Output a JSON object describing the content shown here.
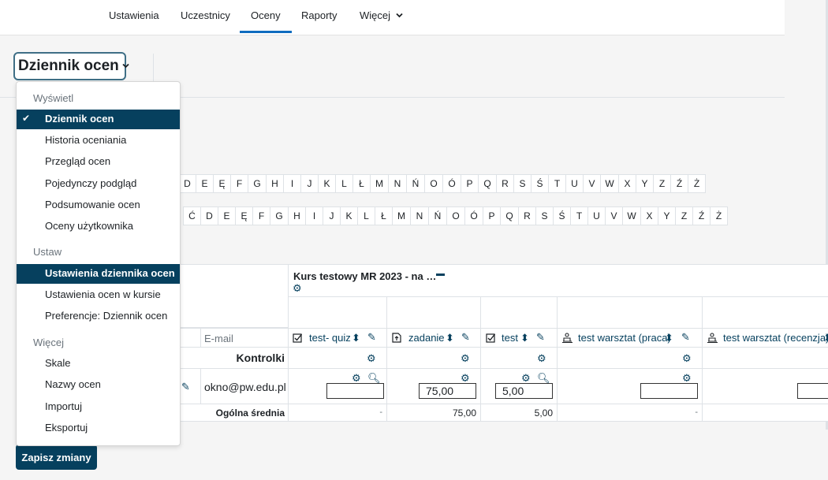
{
  "topnav": {
    "items": [
      {
        "label": "Ustawienia"
      },
      {
        "label": "Uczestnicy"
      },
      {
        "label": "Oceny",
        "active": true
      },
      {
        "label": "Raporty"
      },
      {
        "label": "Więcej"
      }
    ],
    "more_icon": "chevron-down-icon"
  },
  "selector": {
    "label": "Dziennik ocen",
    "icon": "chevron-down-icon"
  },
  "dropdown": {
    "section_view": "Wyświetl",
    "view_items": [
      "Dziennik ocen",
      "Historia oceniania",
      "Przegląd ocen",
      "Pojedynczy podgląd",
      "Podsumowanie ocen",
      "Oceny użytkownika"
    ],
    "section_setup": "Ustaw",
    "setup_items": [
      "Ustawienia dziennika ocen",
      "Ustawienia ocen w kursie",
      "Preferencje: Dziennik ocen"
    ],
    "section_more": "Więcej",
    "more_items": [
      "Skale",
      "Nazwy ocen",
      "Importuj",
      "Eksportuj"
    ],
    "selected": [
      "Dziennik ocen",
      "Ustawienia dziennika ocen"
    ],
    "check_icon": "check-icon"
  },
  "filters": {
    "row1": [
      "D",
      "E",
      "Ę",
      "F",
      "G",
      "H",
      "I",
      "J",
      "K",
      "L",
      "Ł",
      "M",
      "N",
      "Ń",
      "O",
      "Ó",
      "P",
      "Q",
      "R",
      "S",
      "Ś",
      "T",
      "U",
      "V",
      "W",
      "X",
      "Y",
      "Z",
      "Ź",
      "Ż"
    ],
    "row2": [
      "Ć",
      "D",
      "E",
      "Ę",
      "F",
      "G",
      "H",
      "I",
      "J",
      "K",
      "L",
      "Ł",
      "M",
      "N",
      "Ń",
      "O",
      "Ó",
      "P",
      "Q",
      "R",
      "S",
      "Ś",
      "T",
      "U",
      "V",
      "W",
      "X",
      "Y",
      "Z",
      "Ź",
      "Ż"
    ]
  },
  "table": {
    "category": {
      "title": "Kurs testowy MR 2023 - na …",
      "collapse_icon": "minus-icon",
      "settings_icon": "gear-icon"
    },
    "email_header": "E-mail",
    "columns": [
      {
        "name": "test- quiz",
        "icon": "checkbox-icon"
      },
      {
        "name": "zadanie",
        "icon": "assignment-icon"
      },
      {
        "name": "test",
        "icon": "checkbox-icon"
      },
      {
        "name": "test warsztat (praca)",
        "icon": "workshop-icon"
      },
      {
        "name": "test warsztat (recenzja)",
        "icon": "workshop-icon"
      }
    ],
    "controls_label": "Kontrolki",
    "student": {
      "email": "okno@pw.edu.pl",
      "grades": [
        "",
        "75,00",
        "5,00",
        "",
        ""
      ]
    },
    "overall_label": "Ogólna średnia",
    "overall": [
      "-",
      "75,00",
      "5,00",
      "-"
    ],
    "sort_icon": "sort-icon",
    "edit_icon": "pencil-icon",
    "zoom_icon": "search-plus-icon"
  },
  "save_button": "Zapisz zmiany",
  "colors": {
    "selected_bg": "#06405e",
    "icon": "#06405e",
    "active_tab": "#0f6cbf"
  }
}
